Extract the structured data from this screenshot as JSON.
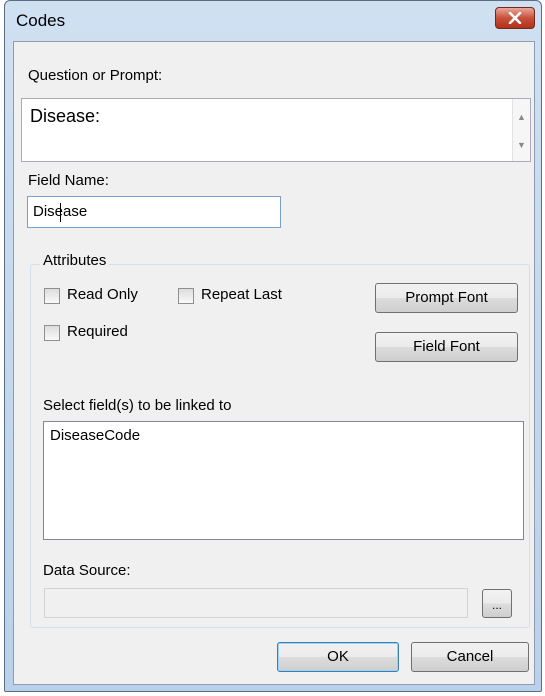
{
  "window": {
    "title": "Codes"
  },
  "prompt": {
    "label": "Question or Prompt:",
    "value": "Disease:"
  },
  "field_name": {
    "label": "Field Name:",
    "value": "Disease"
  },
  "attributes": {
    "title": "Attributes",
    "read_only": {
      "label": "Read Only",
      "checked": false
    },
    "repeat_last": {
      "label": "Repeat Last",
      "checked": false
    },
    "required": {
      "label": "Required",
      "checked": false
    },
    "prompt_font_label": "Prompt Font",
    "field_font_label": "Field Font"
  },
  "linked_fields": {
    "label": "Select field(s) to be linked to",
    "items": [
      "DiseaseCode"
    ]
  },
  "data_source": {
    "label": "Data Source:",
    "value": "",
    "browse_label": "..."
  },
  "buttons": {
    "ok": "OK",
    "cancel": "Cancel"
  },
  "icons": {
    "close": "close-icon",
    "scroll_up": "scroll-up-arrow-icon",
    "scroll_down": "scroll-down-arrow-icon"
  },
  "colors": {
    "close_button": "#c7503a",
    "window_frame": "#b9d1ea",
    "client_bg": "#f0f0f0"
  }
}
